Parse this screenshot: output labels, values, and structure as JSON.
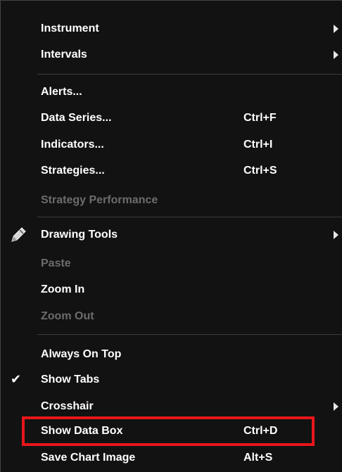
{
  "menu": {
    "items": [
      {
        "label": "Instrument",
        "shortcut": "",
        "submenu": true,
        "enabled": true
      },
      {
        "label": "Intervals",
        "shortcut": "",
        "submenu": true,
        "enabled": true
      },
      {
        "label": "Alerts...",
        "shortcut": "",
        "submenu": false,
        "enabled": true
      },
      {
        "label": "Data Series...",
        "shortcut": "Ctrl+F",
        "submenu": false,
        "enabled": true
      },
      {
        "label": "Indicators...",
        "shortcut": "Ctrl+I",
        "submenu": false,
        "enabled": true
      },
      {
        "label": "Strategies...",
        "shortcut": "Ctrl+S",
        "submenu": false,
        "enabled": true
      },
      {
        "label": "Strategy Performance",
        "shortcut": "",
        "submenu": false,
        "enabled": false
      },
      {
        "label": "Drawing Tools",
        "shortcut": "",
        "submenu": true,
        "enabled": true,
        "icon": "pencil-icon"
      },
      {
        "label": "Paste",
        "shortcut": "",
        "submenu": false,
        "enabled": false
      },
      {
        "label": "Zoom In",
        "shortcut": "",
        "submenu": false,
        "enabled": true
      },
      {
        "label": "Zoom Out",
        "shortcut": "",
        "submenu": false,
        "enabled": false
      },
      {
        "label": "Always On Top",
        "shortcut": "",
        "submenu": false,
        "enabled": true
      },
      {
        "label": "Show Tabs",
        "shortcut": "",
        "submenu": false,
        "enabled": true,
        "checked": true
      },
      {
        "label": "Crosshair",
        "shortcut": "",
        "submenu": true,
        "enabled": true
      },
      {
        "label": "Show Data Box",
        "shortcut": "Ctrl+D",
        "submenu": false,
        "enabled": true,
        "highlighted": true
      },
      {
        "label": "Save Chart Image",
        "shortcut": "Alt+S",
        "submenu": false,
        "enabled": true
      }
    ]
  },
  "colors": {
    "background": "#121212",
    "text": "#ffffff",
    "disabled_text": "#6c6c6c",
    "highlight_border": "#e8161b"
  }
}
